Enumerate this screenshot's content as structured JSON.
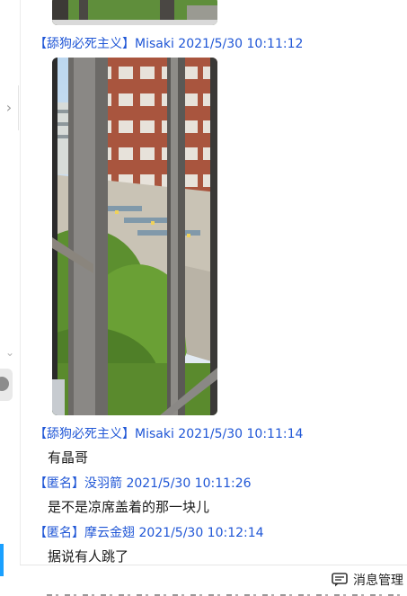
{
  "messages": [
    {
      "header": "【舔狗必死主义】Misaki 2021/5/30 10:11:12"
    },
    {
      "header": "【舔狗必死主义】Misaki 2021/5/30 10:11:14",
      "text": "有晶哥"
    },
    {
      "header": "【匿名】没羽箭 2021/5/30 10:11:26",
      "text": "是不是凉席盖着的那一块儿"
    },
    {
      "header": "【匿名】摩云金翅 2021/5/30 10:12:14",
      "text": "据说有人跳了"
    }
  ],
  "footer": {
    "manage_label": "消息管理"
  },
  "icons": {
    "collapse": "chevron-right-icon",
    "expand": "chevron-down-icon",
    "message": "message-icon"
  },
  "colors": {
    "header": "#1f56d6",
    "accent_tab": "#1aa0ff"
  }
}
